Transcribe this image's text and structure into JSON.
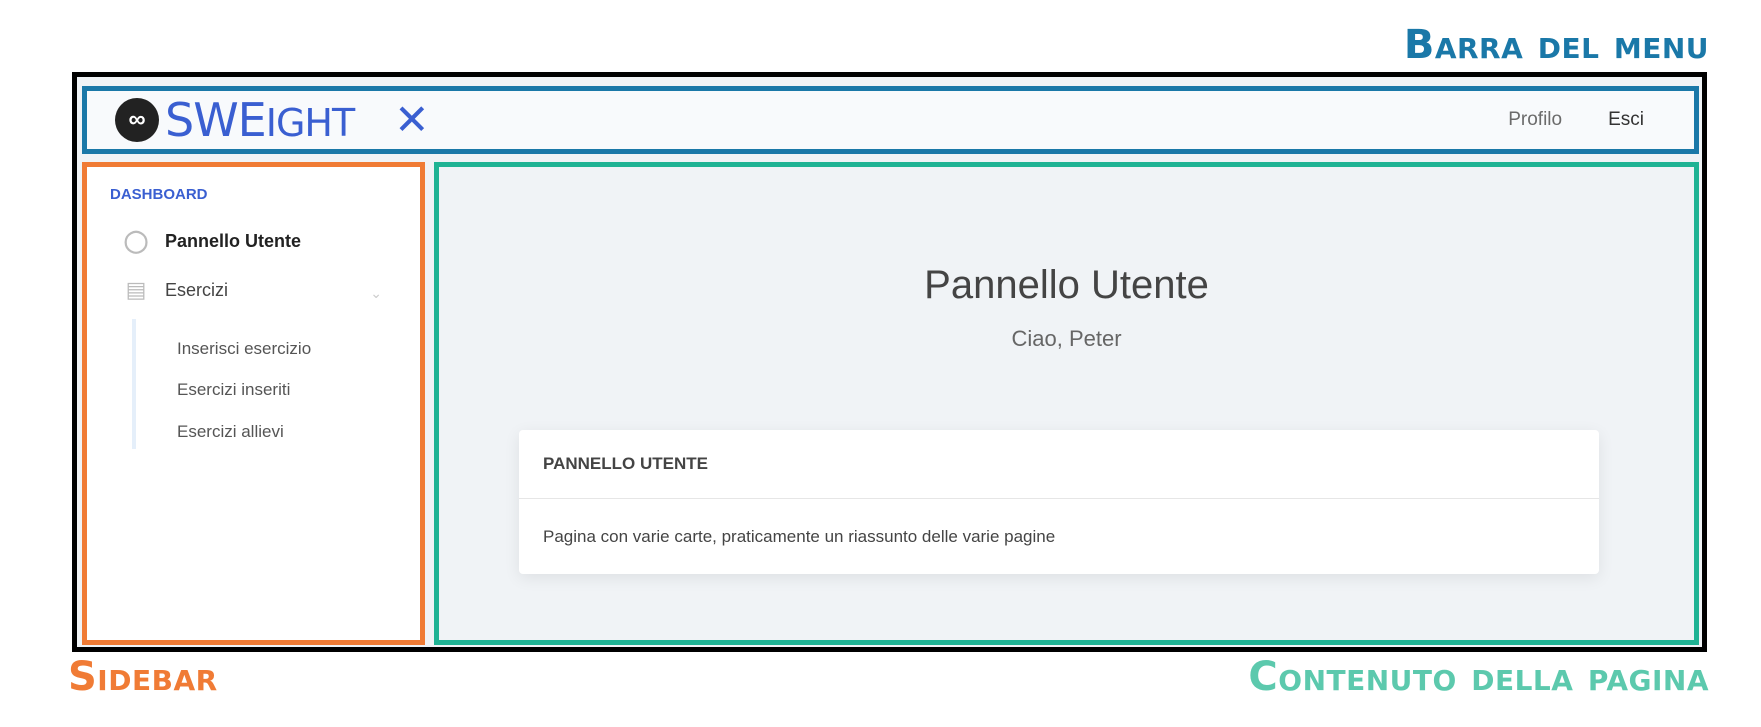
{
  "annotations": {
    "top": "Barra del menu",
    "sidebar": "Sidebar",
    "content": "Contenuto della pagina"
  },
  "topbar": {
    "logo": {
      "icon": "link-icon",
      "text_main": "SWE",
      "text_tail": "IGHT"
    },
    "close_icon": "close-icon",
    "nav": {
      "profile": "Profilo",
      "logout": "Esci"
    }
  },
  "sidebar": {
    "heading": "DASHBOARD",
    "items": [
      {
        "label": "Pannello Utente",
        "icon": "user-icon"
      },
      {
        "label": "Esercizi",
        "icon": "car-icon"
      }
    ],
    "subitems": [
      {
        "label": "Inserisci esercizio"
      },
      {
        "label": "Esercizi inseriti"
      },
      {
        "label": "Esercizi allievi"
      }
    ]
  },
  "main": {
    "title": "Pannello Utente",
    "subtitle": "Ciao, Peter",
    "card": {
      "header": "PANNELLO UTENTE",
      "body": "Pagina con varie carte, praticamente un riassunto delle varie pagine"
    }
  }
}
